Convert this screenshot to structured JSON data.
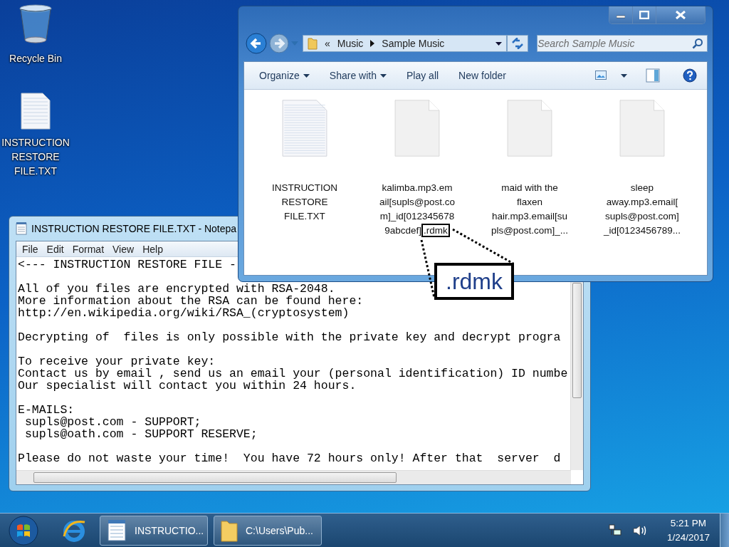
{
  "desktop_icons": [
    {
      "kind": "recycle-bin",
      "lines": [
        "Recycle Bin"
      ]
    },
    {
      "kind": "text-file",
      "lines": [
        "INSTRUCTION",
        "RESTORE",
        "FILE.TXT"
      ]
    }
  ],
  "explorer": {
    "overflow": "«",
    "breadcrumb": [
      "Music",
      "Sample Music"
    ],
    "search": {
      "placeholder": "Search Sample Music"
    },
    "toolbar": [
      {
        "label": "Organize",
        "dropdown": true
      },
      {
        "label": "Share with",
        "dropdown": true
      },
      {
        "label": "Play all",
        "dropdown": false
      },
      {
        "label": "New folder",
        "dropdown": false
      }
    ],
    "files": [
      {
        "kind": "text",
        "lines": [
          "INSTRUCTION",
          "RESTORE",
          "FILE.TXT"
        ]
      },
      {
        "kind": "blank",
        "lines": [
          "kalimba.mp3.em",
          "ail[supls@post.co",
          "m]_id[012345678",
          "9abcdef]"
        ],
        "marked": ".rdmk"
      },
      {
        "kind": "blank",
        "lines": [
          "maid with the",
          "flaxen",
          "hair.mp3.email[su",
          "pls@post.com]_..."
        ]
      },
      {
        "kind": "blank",
        "lines": [
          "sleep",
          "away.mp3.email[",
          "supls@post.com]",
          "_id[0123456789..."
        ]
      }
    ]
  },
  "callout": {
    "text": ".rdmk"
  },
  "notepad": {
    "title": "INSTRUCTION RESTORE FILE.TXT - Notepa",
    "menu": [
      "File",
      "Edit",
      "Format",
      "View",
      "Help"
    ],
    "paragraphs": [
      [
        "<--- INSTRUCTION RESTORE FILE -"
      ],
      [
        "All of you files are encrypted with RSA-2048.",
        "More information about the RSA can be found here:",
        "http://en.wikipedia.org/wiki/RSA_(cryptosystem)"
      ],
      [
        "Decrypting of  files is only possible with the private key and decrypt progra"
      ],
      [
        "To receive your private key:",
        "Contact us by email , send us an email your (personal identification) ID numbe",
        "Our specialist will contact you within 24 hours."
      ],
      [
        "E-MAILS:",
        " supls@post.com - SUPPORT;",
        " supls@oath.com - SUPPORT RESERVE;"
      ],
      [
        "Please do not waste your time!  You have 72 hours only! After that  server  d"
      ]
    ]
  },
  "taskbar": {
    "tasks": [
      {
        "kind": "notepad",
        "label": "INSTRUCTIO..."
      },
      {
        "kind": "folder",
        "label": "C:\\Users\\Pub..."
      }
    ],
    "time": "5:21 PM",
    "date": "1/24/2017"
  }
}
